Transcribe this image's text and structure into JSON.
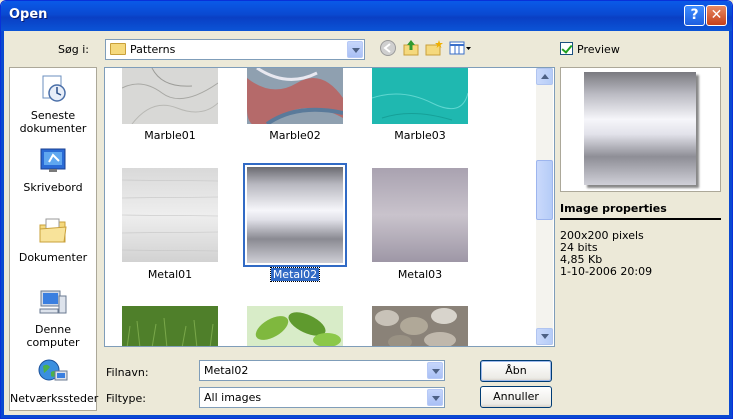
{
  "window": {
    "title": "Open",
    "help_label": "?",
    "close_label": "✕"
  },
  "lookin": {
    "label": "Søg i:",
    "value": "Patterns"
  },
  "toolbar_icons": [
    "back-icon",
    "up-folder-icon",
    "new-folder-icon",
    "views-menu-icon"
  ],
  "places": [
    {
      "id": "recent",
      "label": "Seneste dokumenter",
      "icon": "recent-documents-icon"
    },
    {
      "id": "desktop",
      "label": "Skrivebord",
      "icon": "desktop-icon"
    },
    {
      "id": "documents",
      "label": "Dokumenter",
      "icon": "documents-folder-icon"
    },
    {
      "id": "computer",
      "label": "Denne computer",
      "icon": "computer-icon"
    },
    {
      "id": "network",
      "label": "Netværkssteder",
      "icon": "network-places-icon"
    }
  ],
  "files": [
    {
      "name": "Marble01",
      "texture": "marble-gray"
    },
    {
      "name": "Marble02",
      "texture": "marble-red"
    },
    {
      "name": "Marble03",
      "texture": "marble-teal"
    },
    {
      "name": "Metal01",
      "texture": "brushed-metal"
    },
    {
      "name": "Metal02",
      "texture": "chrome-gradient",
      "selected": true
    },
    {
      "name": "Metal03",
      "texture": "purple-metal"
    },
    {
      "name": "",
      "texture": "grass"
    },
    {
      "name": "",
      "texture": "leaves"
    },
    {
      "name": "",
      "texture": "pebbles"
    }
  ],
  "filename": {
    "label": "Filnavn:",
    "value": "Metal02"
  },
  "filetype": {
    "label": "Filtype:",
    "value": "All images"
  },
  "buttons": {
    "open": "Åbn",
    "cancel": "Annuller"
  },
  "preview": {
    "checkbox_label": "Preview",
    "checked": true
  },
  "image_properties": {
    "heading": "Image properties",
    "dimensions": "200x200 pixels",
    "bits": "24 bits",
    "size": "4,85 Kb",
    "date": "1-10-2006 20:09"
  },
  "colors": {
    "titlebar": "#0a49d1",
    "selection": "#316ac5",
    "dialog_bg": "#ece9d8"
  }
}
